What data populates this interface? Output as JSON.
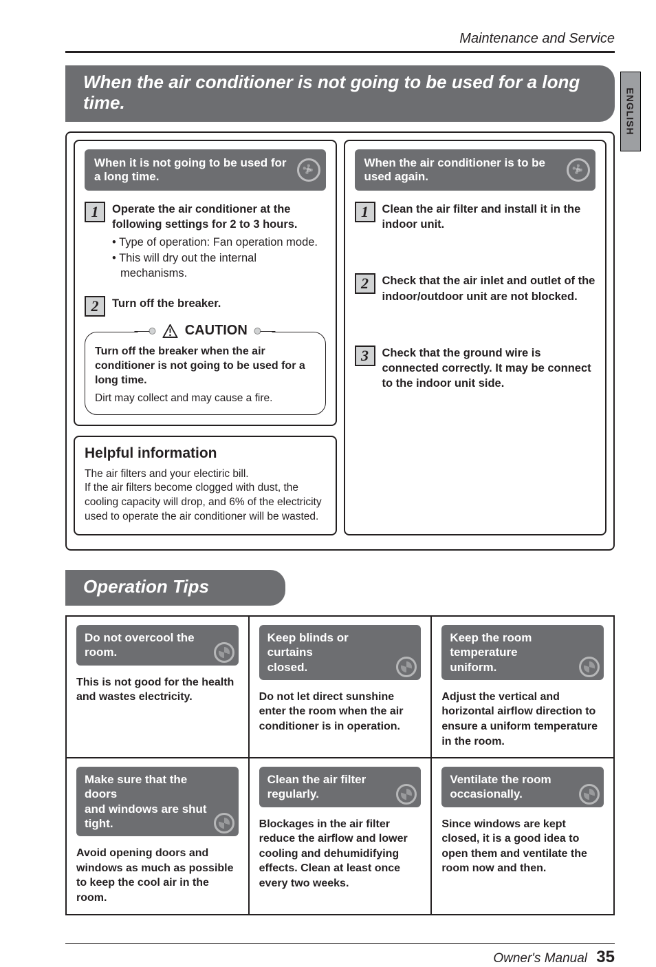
{
  "header": {
    "section": "Maintenance and Service",
    "side_tab": "ENGLISH"
  },
  "pill1": "When the air conditioner is not going to be used for a long time.",
  "left": {
    "box1": {
      "heading": "When it is not going to be used for\na long time.",
      "step1": {
        "num": "1",
        "title": "Operate the air conditioner at the following settings for 2 to 3 hours.",
        "b1": "Type of operation: Fan operation mode.",
        "b2": "This will dry out the internal mechanisms."
      },
      "step2": {
        "num": "2",
        "title": "Turn off the breaker."
      },
      "caution": {
        "label": "CAUTION",
        "bold": "Turn off the breaker when the air conditioner is not going to be used for a long time.",
        "note": "Dirt may collect and may cause a fire."
      }
    },
    "box2": {
      "h": "Helpful information",
      "p": "The air filters and your electiric bill.\nIf the air filters become clogged with dust, the cooling capacity will drop, and 6% of the electricity used to operate the air conditioner will be wasted."
    }
  },
  "right": {
    "heading": "When the air conditioner is to be used again.",
    "s1": {
      "num": "1",
      "t": "Clean the air filter and install it in the indoor unit."
    },
    "s2": {
      "num": "2",
      "t": "Check that the air inlet and outlet of the indoor/outdoor unit are not blocked."
    },
    "s3": {
      "num": "3",
      "t": "Check that the ground wire is connected correctly. It may be connect to the indoor unit side."
    }
  },
  "pill2": "Operation Tips",
  "tips": {
    "r1c1h": "Do not overcool the room.",
    "r1c2h": "Keep blinds or curtains\nclosed.",
    "r1c3h": "Keep the room temperature\nuniform.",
    "r1c1b": "This is not good for the health and wastes electricity.",
    "r1c2b": "Do not let direct sunshine enter the room when the air conditioner is in operation.",
    "r1c3b": "Adjust the vertical and horizontal airflow direction to ensure a uniform temperature in the room.",
    "r2c1h": "Make sure that the doors\nand windows are shut tight.",
    "r2c2h": "Clean the air filter regularly.",
    "r2c3h": "Ventilate the room\noccasionally.",
    "r2c1b": "Avoid opening doors and windows as much as possible to keep the cool air in the room.",
    "r2c2b": "Blockages in the air filter reduce the airflow and lower cooling and dehumidifying effects. Clean at least once every two weeks.",
    "r2c3b": "Since windows are kept closed, it is a good idea to open them and ventilate the room now and then."
  },
  "footer": {
    "label": "Owner's Manual",
    "page": "35"
  }
}
